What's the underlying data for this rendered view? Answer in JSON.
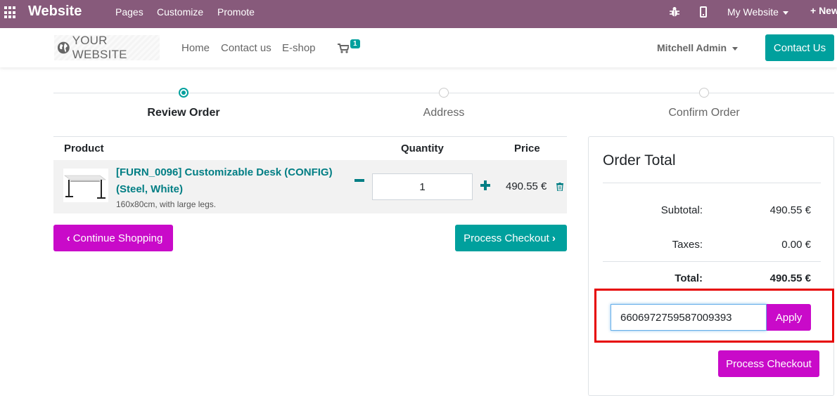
{
  "topbar": {
    "brand": "Website",
    "menu": [
      "Pages",
      "Customize",
      "Promote"
    ],
    "my_website": "My Website",
    "new_label": "+ New"
  },
  "navbar": {
    "logo_text": "YOUR WEBSITE",
    "links": [
      "Home",
      "Contact us",
      "E-shop"
    ],
    "cart_count": "1",
    "user": "Mitchell Admin",
    "contact_button": "Contact Us"
  },
  "steps": [
    {
      "label": "Review Order",
      "active": true
    },
    {
      "label": "Address",
      "active": false
    },
    {
      "label": "Confirm Order",
      "active": false
    }
  ],
  "cart": {
    "headers": {
      "product": "Product",
      "quantity": "Quantity",
      "price": "Price"
    },
    "items": [
      {
        "name": "[FURN_0096] Customizable Desk (CONFIG) (Steel, White)",
        "description": "160x80cm, with large legs.",
        "quantity": "1",
        "price": "490.55 €"
      }
    ],
    "continue_label": "Continue Shopping",
    "process_label": "Process Checkout"
  },
  "order_total": {
    "title": "Order Total",
    "subtotal_label": "Subtotal:",
    "subtotal_value": "490.55 €",
    "taxes_label": "Taxes:",
    "taxes_value": "0.00 €",
    "total_label": "Total:",
    "total_value": "490.55 €",
    "promo_value": "6606972759587009393",
    "apply_label": "Apply",
    "checkout_label": "Process Checkout"
  },
  "colors": {
    "topbar": "#875a7b",
    "primary": "#00a09d",
    "secondary": "#c90ac9",
    "product_link": "#017e84",
    "highlight": "#e60000"
  }
}
